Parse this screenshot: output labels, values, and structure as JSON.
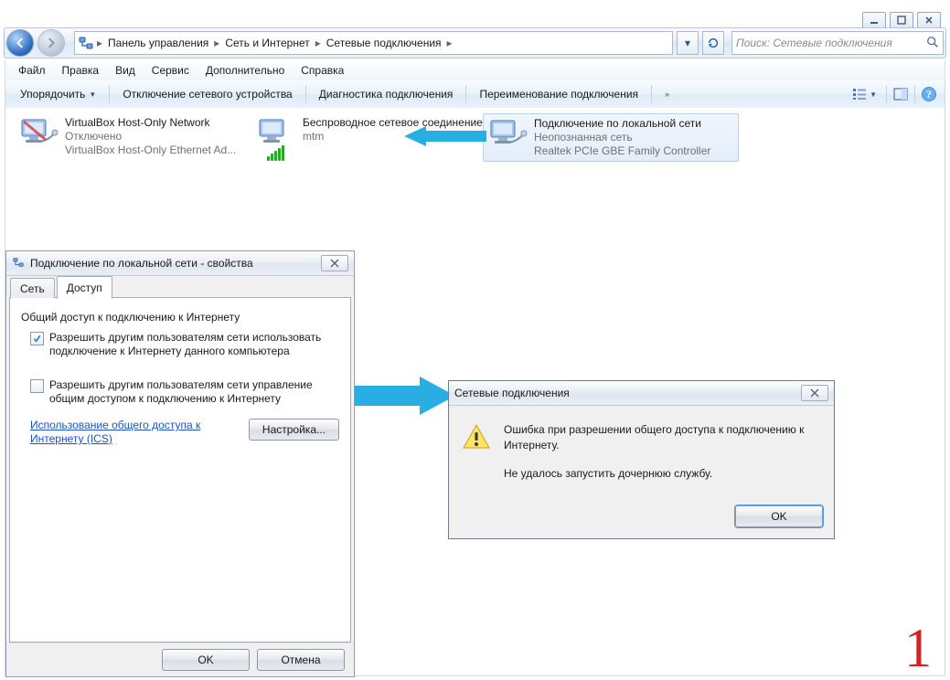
{
  "window_controls": {
    "min": "_",
    "max": "▢",
    "close": "✕"
  },
  "breadcrumb": {
    "seg1": "Панель управления",
    "seg2": "Сеть и Интернет",
    "seg3": "Сетевые подключения"
  },
  "search": {
    "placeholder": "Поиск: Сетевые подключения"
  },
  "menu": {
    "file": "Файл",
    "edit": "Правка",
    "view": "Вид",
    "service": "Сервис",
    "extra": "Дополнительно",
    "help": "Справка"
  },
  "toolbar": {
    "organize": "Упорядочить",
    "disable": "Отключение сетевого устройства",
    "diagnose": "Диагностика подключения",
    "rename": "Переименование подключения",
    "more": "»"
  },
  "connections": {
    "c1": {
      "title": "VirtualBox Host-Only Network",
      "status": "Отключено",
      "device": "VirtualBox Host-Only Ethernet Ad..."
    },
    "c2": {
      "title": "Беспроводное сетевое соединение",
      "status": "mtm"
    },
    "c3": {
      "title": "Подключение по локальной сети",
      "status": "Неопознанная сеть",
      "device": "Realtek PCIe GBE Family Controller"
    }
  },
  "props": {
    "title": "Подключение по локальной сети - свойства",
    "tab_net": "Сеть",
    "tab_access": "Доступ",
    "group": "Общий доступ к подключению к Интернету",
    "check1": "Разрешить другим пользователям сети использовать подключение к Интернету данного компьютера",
    "check2": "Разрешить другим пользователям сети управление общим доступом к подключению к Интернету",
    "ics_link": "Использование общего доступа к Интернету (ICS)",
    "settings_btn": "Настройка...",
    "ok": "OK",
    "cancel": "Отмена"
  },
  "error_dlg": {
    "title": "Сетевые подключения",
    "line1": "Ошибка при разрешении общего доступа к подключению к Интернету.",
    "line2": "Не удалось запустить дочернюю службу.",
    "ok": "OK"
  },
  "big_digit": "1"
}
